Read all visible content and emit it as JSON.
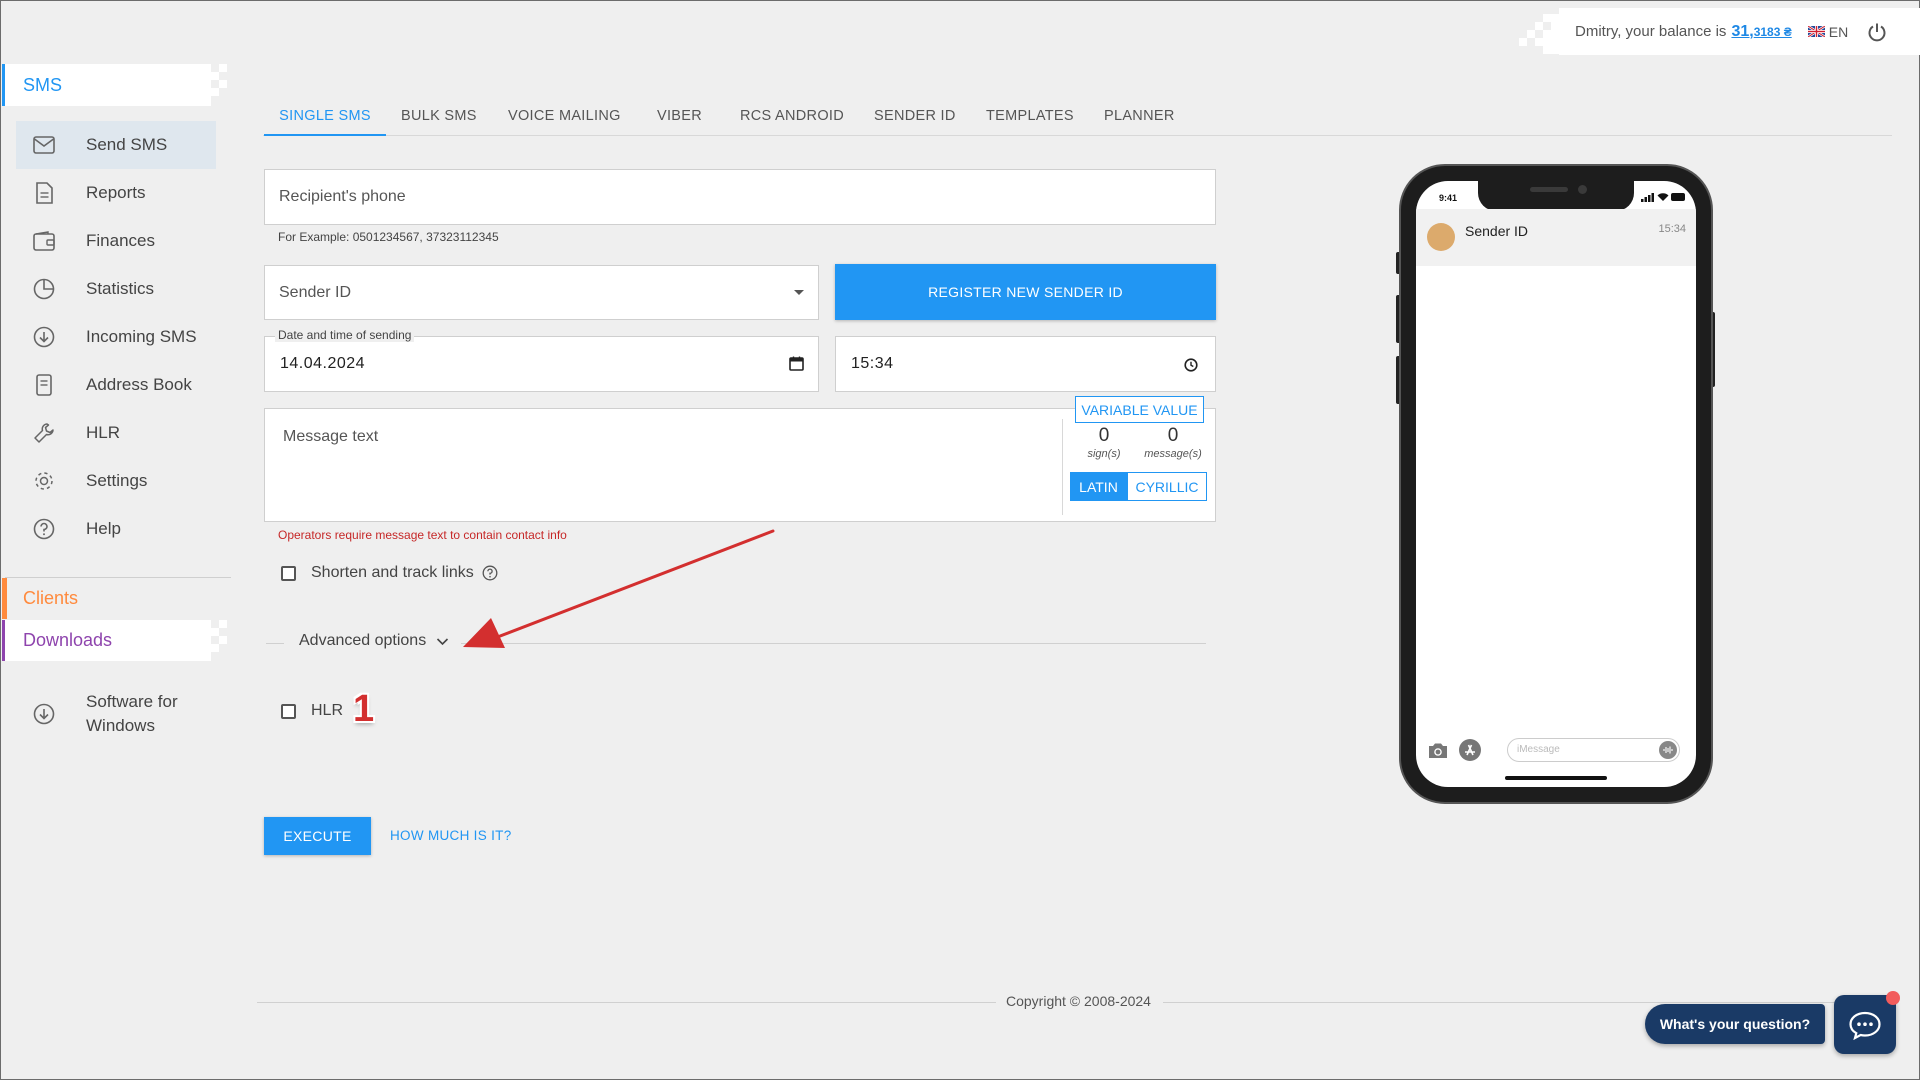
{
  "header": {
    "greeting": "Dmitry, your balance is",
    "balance_int": "31,",
    "balance_frac": "3183 ₴",
    "language": "EN"
  },
  "sidebar": {
    "section_sms": "SMS",
    "items": [
      {
        "label": "Send SMS",
        "icon": "envelope-icon"
      },
      {
        "label": "Reports",
        "icon": "document-icon"
      },
      {
        "label": "Finances",
        "icon": "wallet-icon"
      },
      {
        "label": "Statistics",
        "icon": "pie-chart-icon"
      },
      {
        "label": "Incoming SMS",
        "icon": "download-circle-icon"
      },
      {
        "label": "Address Book",
        "icon": "book-icon"
      },
      {
        "label": "HLR",
        "icon": "wrench-icon"
      },
      {
        "label": "Settings",
        "icon": "gear-icon"
      },
      {
        "label": "Help",
        "icon": "help-circle-icon"
      }
    ],
    "section_clients": "Clients",
    "section_downloads": "Downloads",
    "software_line1": "Software for",
    "software_line2": "Windows"
  },
  "tabs": [
    "SINGLE SMS",
    "BULK SMS",
    "VOICE MAILING",
    "VIBER",
    "RCS ANDROID",
    "SENDER ID",
    "TEMPLATES",
    "PLANNER"
  ],
  "form": {
    "recipient_placeholder": "Recipient's phone",
    "recipient_hint": "For Example: 0501234567, 37323112345",
    "sender_id_label": "Sender ID",
    "register_button": "REGISTER NEW SENDER ID",
    "date_legend": "Date and time of sending",
    "date_value": "14.04.2024",
    "time_value": "15:34",
    "message_placeholder": "Message text",
    "variable_value": "VARIABLE VALUE",
    "signs_count": "0",
    "signs_label": "sign(s)",
    "messages_count": "0",
    "messages_label": "message(s)",
    "latin": "LATIN",
    "cyrillic": "CYRILLIC",
    "error_text": "Operators require message text to contain contact info",
    "shorten_links": "Shorten and track links",
    "advanced_options": "Advanced options",
    "hlr_label": "HLR",
    "annotation_number": "1",
    "execute": "EXECUTE",
    "how_much": "HOW MUCH IS IT?"
  },
  "phone": {
    "status_time": "9:41",
    "contact": "Sender ID",
    "message_time": "15:34",
    "imessage_placeholder": "iMessage"
  },
  "footer": {
    "copyright": "Copyright © 2008-2024"
  },
  "chat": {
    "question": "What's your question?"
  },
  "colors": {
    "accent": "#2196f3",
    "clients": "#ff8a3d",
    "downloads": "#8e44ad",
    "error": "#c62828",
    "chat_bg": "#1a3a66"
  }
}
